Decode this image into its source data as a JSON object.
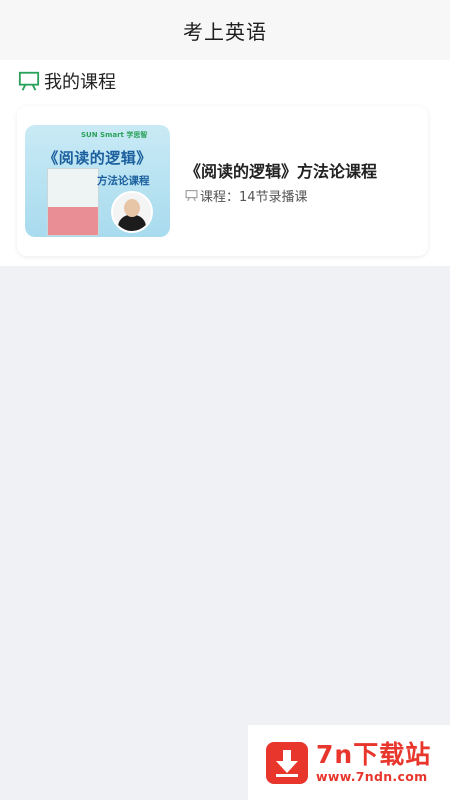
{
  "header": {
    "title": "考上英语"
  },
  "section": {
    "title": "我的课程",
    "icon": "blackboard-icon"
  },
  "course": {
    "cover": {
      "brand": "SUN Smart 学思智",
      "title": "《阅读的逻辑》",
      "subtitle": "方法论课程"
    },
    "title": "《阅读的逻辑》方法论课程",
    "meta": "课程：14节录播课"
  },
  "watermark": {
    "title": "7n下载站",
    "url": "www.7ndn.com"
  },
  "colors": {
    "accent_green": "#2aa15a",
    "watermark_red": "#e8362c"
  }
}
